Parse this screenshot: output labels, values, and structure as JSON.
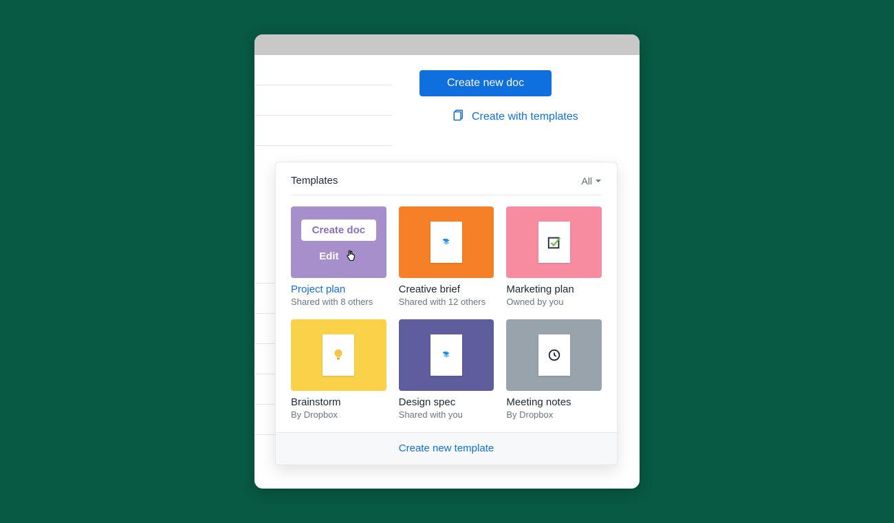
{
  "actions": {
    "create_doc": "Create new doc",
    "create_with_templates": "Create with templates"
  },
  "panel": {
    "title": "Templates",
    "filter_label": "All",
    "footer_link": "Create new template",
    "hover": {
      "create_label": "Create doc",
      "edit_label": "Edit"
    }
  },
  "templates": [
    {
      "title": "Project plan",
      "subtitle": "Shared with 8 others",
      "color": "bg-purple",
      "icon": "hover",
      "link_style": true
    },
    {
      "title": "Creative brief",
      "subtitle": "Shared with 12 others",
      "color": "bg-orange",
      "icon": "dropbox",
      "link_style": false
    },
    {
      "title": "Marketing plan",
      "subtitle": "Owned by you",
      "color": "bg-pink",
      "icon": "checkmark",
      "link_style": false
    },
    {
      "title": "Brainstorm",
      "subtitle": "By Dropbox",
      "color": "bg-yellow",
      "icon": "bulb",
      "link_style": false
    },
    {
      "title": "Design spec",
      "subtitle": "Shared with you",
      "color": "bg-indigo",
      "icon": "dropbox",
      "link_style": false
    },
    {
      "title": "Meeting notes",
      "subtitle": "By Dropbox",
      "color": "bg-grey",
      "icon": "clock",
      "link_style": false
    }
  ]
}
